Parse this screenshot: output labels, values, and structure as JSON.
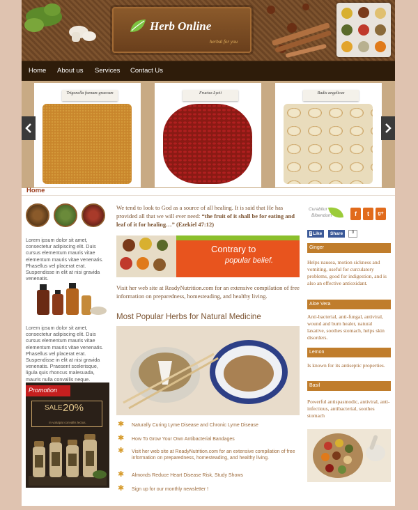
{
  "site": {
    "title": "Herb Online",
    "tagline": "herbal for you"
  },
  "nav": {
    "items": [
      "Home",
      "About us",
      "Services",
      "Contact Us"
    ]
  },
  "slider": {
    "slides": [
      {
        "label": "Trigonella foenum-graecum"
      },
      {
        "label": "Fructus Lycii"
      },
      {
        "label": "Radix angelicae"
      }
    ],
    "prev_icon": "chevron-left-icon",
    "next_icon": "chevron-right-icon"
  },
  "breadcrumb": "Home",
  "left": {
    "lorem1": "Lorem ipsum dolor sit amet, consectetur adipiscing elit. Duis cursus elementum mauris vitae elementum mauris vitae venenatis. Phasellus vel placerat erat. Suspendisse in elit at nisi gravida venenatis.",
    "lorem2": "Lorem ipsum dolor sit amet, consectetur adipiscing elit. Duis cursus elementum mauris vitae elementum mauris vitae venenatis. Phasellus vel placerat erat. Suspendisse in elit at nisi gravida venenatis. Praesent scelerisque, ligula quis rhoncus malesuada, mauris nulla convallis neque.",
    "promo": {
      "tab": "Promotion",
      "sale_label": "SALE",
      "sale_value": "20%",
      "sale_sub": "In volutpat convallis lectus."
    }
  },
  "center": {
    "intro_plain": "We tend to look to God as a source of all healing. It is said that He has provided all that we will ever need: ",
    "intro_bold": "“the fruit of it shall be for eating and leaf of it for healing…” (Ezekiel 47:12)",
    "banner_line1": "Contrary to",
    "banner_line2": "popular belief.",
    "visit": "Visit her web site at ReadyNutrition.com for an extensive compilation of free information on preparedness, homesteading, and healthy living.",
    "most_popular": "Most Popular Herbs for Natural Medicine",
    "list": [
      "Naturally Curing Lyme Disease and Chronic Lyme Disease",
      "How To Grow Your Own Antibacterial Bandages",
      "Visit her web site at ReadyNutrition.com for an extensive compilation of free information on preparedness, homesteading, and healthy living.",
      "Almonds Reduce Heart Disease Risk, Study Shows",
      "Sign up for our monthly newsletter !"
    ]
  },
  "right": {
    "logo_line1": "Curabitur",
    "logo_line2": "Bibendum",
    "social": [
      "f",
      "t",
      "g+"
    ],
    "like_label": "Like",
    "share_label": "Share",
    "share_count": "0",
    "herbs": [
      {
        "name": "Ginger",
        "desc": "Helps nausea, motion sickness and vomiting, useful for curculatory problems, good for indigestion, and is also an effective antioxidant."
      },
      {
        "name": "Aloe Vera",
        "desc": "Anti-bacterial, anti-fungal, antiviral, wound and burn healer, natural laxative, soothes stomach, helps skin disorders."
      },
      {
        "name": "Lemon",
        "desc": "Is known for its antiseptic properties."
      },
      {
        "name": "Basil",
        "desc": "Powerful antispasmodic, antiviral, anti-infectious, antibacterial, soothes stomach"
      }
    ]
  },
  "colors": {
    "nav_bg": "#2e1c0a",
    "accent": "#c07d2c",
    "text_brown": "#7a5230",
    "promo_red": "#c51f1f",
    "banner_orange": "#e8541e"
  }
}
